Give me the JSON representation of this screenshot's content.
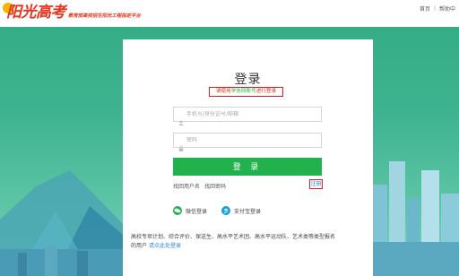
{
  "header": {
    "logo_title": "阳光高考",
    "logo_subtitle": "教育部高校招生阳光工程指定平台",
    "nav": [
      "首页",
      "帮助中"
    ],
    "nav_separator": "|"
  },
  "login": {
    "title": "登录",
    "notice_prefix": "请使用",
    "notice_highlight": "学信网账号",
    "notice_suffix": "进行登录",
    "username_placeholder": "手机号/身份证号/邮箱",
    "password_placeholder": "密码",
    "login_button": "登 录",
    "recover_username": "找回用户名",
    "recover_password": "找回密码",
    "register": "注册",
    "wechat_login": "微信登录",
    "alipay_login": "支付宝登录",
    "footer_line1": "高校专项计划、综合评价、保送生、高水平艺术团、高水平运动队、艺术类等类型报名",
    "footer_line2_prefix": "的用户",
    "footer_line2_link": "请点此处登录"
  },
  "icons": {
    "wechat": "wechat-icon",
    "alipay": "alipay-icon",
    "user": "user-icon",
    "lock": "lock-icon"
  },
  "colors": {
    "accent_green": "#22b14c",
    "alert_red": "#e02020",
    "link_blue": "#2e86d6",
    "logo_red": "#e8331c",
    "background_teal": "#3eb38f"
  }
}
